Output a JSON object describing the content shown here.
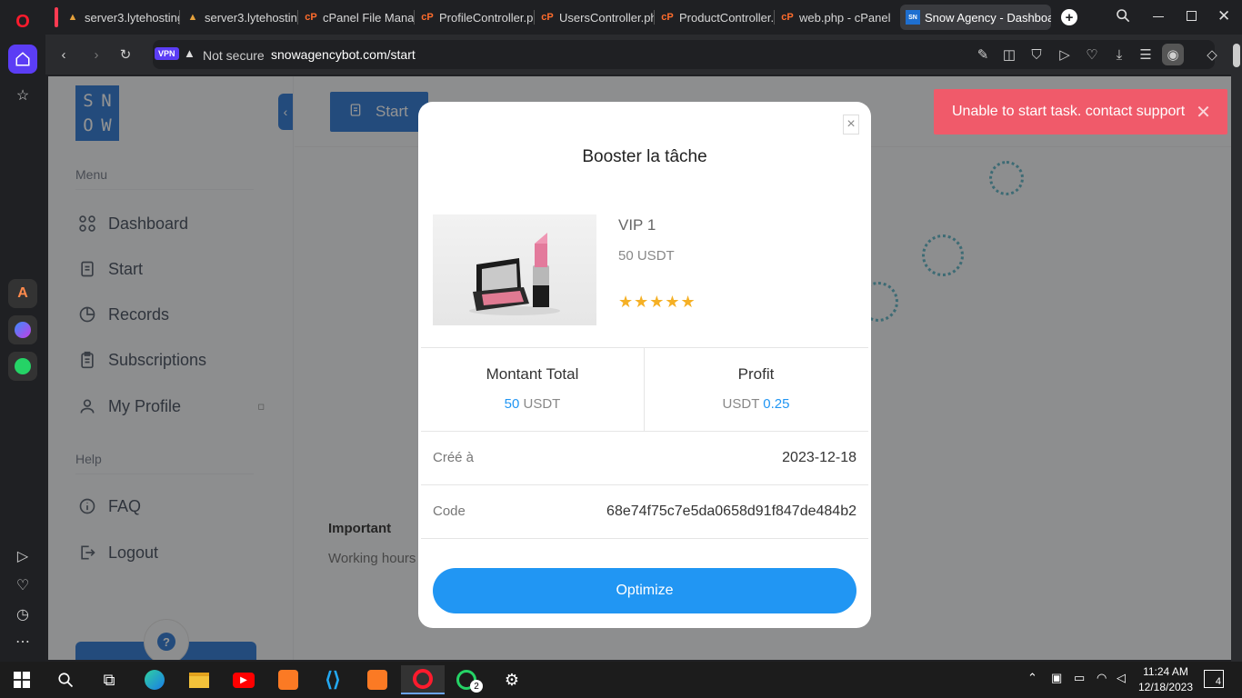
{
  "browser": {
    "tabs": [
      {
        "title": "server3.lytehosting"
      },
      {
        "title": "server3.lytehosting"
      },
      {
        "title": "cPanel File Manage"
      },
      {
        "title": "ProfileController.ph"
      },
      {
        "title": "UsersController.php"
      },
      {
        "title": "ProductController.p"
      },
      {
        "title": "web.php - cPanel F"
      },
      {
        "title": "Snow Agency - Dashboard"
      }
    ],
    "vpn_label": "VPN",
    "security_label": "Not secure",
    "url": "snowagencybot.com/start"
  },
  "sidebar": {
    "logo_letters": [
      "S",
      "N",
      "O",
      "W"
    ],
    "menu_heading": "Menu",
    "items": [
      {
        "label": "Dashboard",
        "icon": "grid-icon"
      },
      {
        "label": "Start",
        "icon": "file-icon"
      },
      {
        "label": "Records",
        "icon": "pie-chart-icon"
      },
      {
        "label": "Subscriptions",
        "icon": "clipboard-icon"
      },
      {
        "label": "My Profile",
        "icon": "user-icon"
      }
    ],
    "help_heading": "Help",
    "help_items": [
      {
        "label": "FAQ",
        "icon": "info-icon"
      },
      {
        "label": "Logout",
        "icon": "logout-icon"
      }
    ],
    "help_bubble": "?"
  },
  "main": {
    "start_button": "Start",
    "important_heading": "Important",
    "working_hours": "Working hours"
  },
  "toast": {
    "message": "Unable to start task. contact support",
    "color": "#f05a6a"
  },
  "modal": {
    "title": "Booster la tâche",
    "vip": "VIP 1",
    "price": "50 USDT",
    "rating": 5,
    "stars": "★★★★★",
    "total_label": "Montant Total",
    "total_value": "50",
    "total_unit": "USDT",
    "profit_label": "Profit",
    "profit_unit": "USDT",
    "profit_value": "0.25",
    "created_label": "Créé à",
    "created_value": "2023-12-18",
    "code_label": "Code",
    "code_value": "68e74f75c7e5da0658d91f847de484b2",
    "optimize_button": "Optimize",
    "accent": "#2196f3"
  },
  "taskbar": {
    "time": "11:24 AM",
    "date": "12/18/2023",
    "whatsapp_badge": "2",
    "notification_count": "4"
  }
}
